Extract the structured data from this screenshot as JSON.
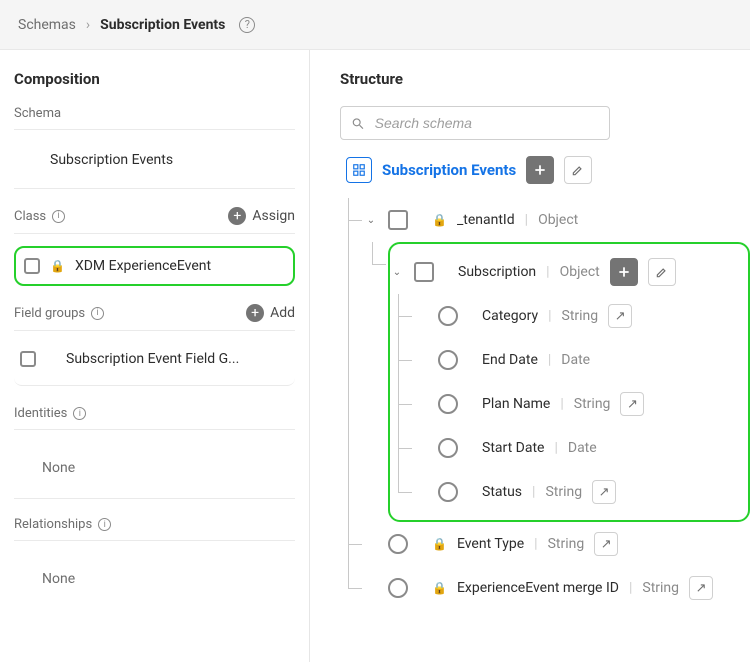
{
  "header": {
    "crumb_root": "Schemas",
    "crumb_current": "Subscription Events"
  },
  "left": {
    "title": "Composition",
    "schema_label": "Schema",
    "schema_name": "Subscription Events",
    "class_label": "Class",
    "assign_label": "Assign",
    "class_name": "XDM ExperienceEvent",
    "field_groups_label": "Field groups",
    "add_label": "Add",
    "field_group_name": "Subscription Event Field G...",
    "identities_label": "Identities",
    "relationships_label": "Relationships",
    "none": "None"
  },
  "right": {
    "title": "Structure",
    "search_placeholder": "Search schema",
    "root": "Subscription Events",
    "tenant": {
      "name": "_tenantId",
      "type": "Object"
    },
    "subscription": {
      "name": "Subscription",
      "type": "Object"
    },
    "fields": [
      {
        "name": "Category",
        "type": "String",
        "arrow": true
      },
      {
        "name": "End Date",
        "type": "Date",
        "arrow": false
      },
      {
        "name": "Plan Name",
        "type": "String",
        "arrow": true
      },
      {
        "name": "Start Date",
        "type": "Date",
        "arrow": false
      },
      {
        "name": "Status",
        "type": "String",
        "arrow": true
      }
    ],
    "event_type": {
      "name": "Event Type",
      "type": "String"
    },
    "merge_id": {
      "name": "ExperienceEvent merge ID",
      "type": "String"
    }
  }
}
